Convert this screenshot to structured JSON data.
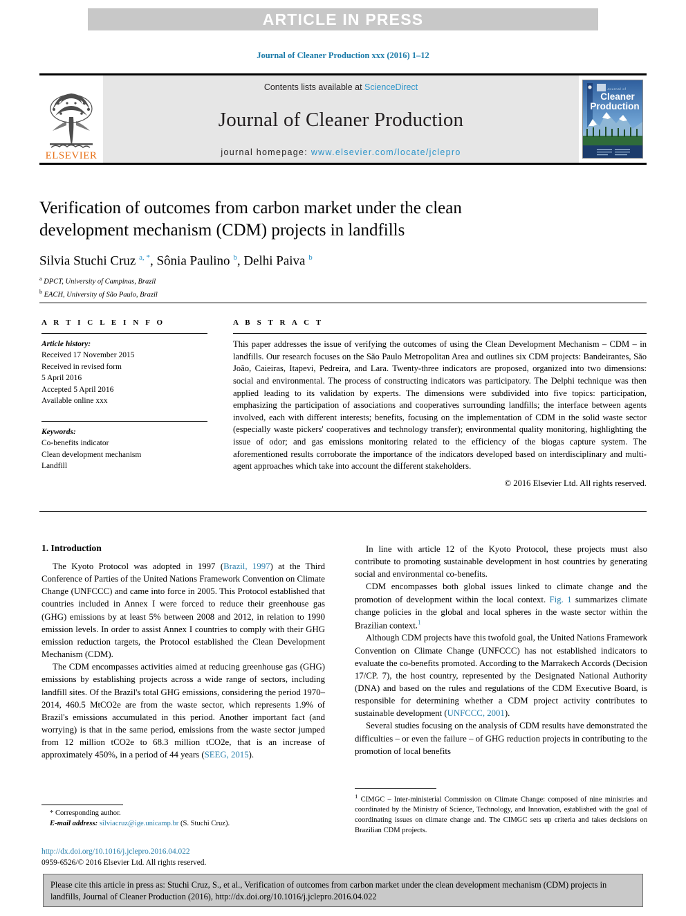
{
  "banner": {
    "text": "ARTICLE IN PRESS"
  },
  "journal_ref": "Journal of Cleaner Production xxx (2016) 1–12",
  "masthead": {
    "publisher": "ELSEVIER",
    "contents_prefix": "Contents lists available at ",
    "contents_link": "ScienceDirect",
    "journal_name": "Journal of Cleaner Production",
    "homepage_prefix": "journal homepage: ",
    "homepage_link": "www.elsevier.com/locate/jclepro",
    "cover_title_small": "Journal of",
    "cover_title_line1": "Cleaner",
    "cover_title_line2": "Production"
  },
  "title": "Verification of outcomes from carbon market under the clean development mechanism (CDM) projects in landfills",
  "authors_html": "Silvia Stuchi Cruz <sup>a, *</sup>, Sônia Paulino <sup>b</sup>, Delhi Paiva <sup>b</sup>",
  "affiliations": [
    {
      "marker": "a",
      "text": "DPCT, University of Campinas, Brazil"
    },
    {
      "marker": "b",
      "text": "EACH, University of São Paulo, Brazil"
    }
  ],
  "article_info": {
    "heading": "A R T I C L E   I N F O",
    "history_label": "Article history:",
    "history_lines": [
      "Received 17 November 2015",
      "Received in revised form",
      "5 April 2016",
      "Accepted 5 April 2016",
      "Available online xxx"
    ],
    "keywords_label": "Keywords:",
    "keywords": [
      "Co-benefits indicator",
      "Clean development mechanism",
      "Landfill"
    ]
  },
  "abstract": {
    "heading": "A B S T R A C T",
    "text": "This paper addresses the issue of verifying the outcomes of using the Clean Development Mechanism – CDM – in landfills. Our research focuses on the São Paulo Metropolitan Area and outlines six CDM projects: Bandeirantes, São João, Caieiras, Itapevi, Pedreira, and Lara. Twenty-three indicators are proposed, organized into two dimensions: social and environmental. The process of constructing indicators was participatory. The Delphi technique was then applied leading to its validation by experts. The dimensions were subdivided into five topics: participation, emphasizing the participation of associations and cooperatives surrounding landfills; the interface between agents involved, each with different interests; benefits, focusing on the implementation of CDM in the solid waste sector (especially waste pickers' cooperatives and technology transfer); environmental quality monitoring, highlighting the issue of odor; and gas emissions monitoring related to the efficiency of the biogas capture system. The aforementioned results corroborate the importance of the indicators developed based on interdisciplinary and multi-agent approaches which take into account the different stakeholders.",
    "copyright": "© 2016 Elsevier Ltd. All rights reserved."
  },
  "body": {
    "section_title": "1. Introduction",
    "left_paragraphs": [
      {
        "pre": "The Kyoto Protocol was adopted in 1997 (",
        "link": "Brazil, 1997",
        "post": ") at the Third Conference of Parties of the United Nations Framework Convention on Climate Change (UNFCCC) and came into force in 2005. This Protocol established that countries included in Annex I were forced to reduce their greenhouse gas (GHG) emissions by at least 5% between 2008 and 2012, in relation to 1990 emission levels. In order to assist Annex I countries to comply with their GHG emission reduction targets, the Protocol established the Clean Development Mechanism (CDM)."
      },
      {
        "pre": "The CDM encompasses activities aimed at reducing greenhouse gas (GHG) emissions by establishing projects across a wide range of sectors, including landfill sites. Of the Brazil's total GHG emissions, considering the period 1970–2014, 460.5 MtCO2e are from the waste sector, which represents 1.9% of Brazil's emissions accumulated in this period. Another important fact (and worrying) is that in the same period, emissions from the waste sector jumped from 12 million tCO2e to 68.3 million tCO2e, that is an increase of approximately 450%, in a period of 44 years (",
        "link": "SEEG, 2015",
        "post": ")."
      }
    ],
    "right_paragraphs": [
      {
        "pre": "In line with article 12 of the Kyoto Protocol, these projects must also contribute to promoting sustainable development in host countries by generating social and environmental co-benefits.",
        "link": "",
        "post": ""
      },
      {
        "pre": "CDM encompasses both global issues linked to climate change and the promotion of development within the local context. ",
        "link": "Fig. 1",
        "post": " summarizes climate change policies in the global and local spheres in the waste sector within the Brazilian context."
      },
      {
        "pre": "Although CDM projects have this twofold goal, the United Nations Framework Convention on Climate Change (UNFCCC) has not established indicators to evaluate the co-benefits promoted. According to the Marrakech Accords (Decision 17/CP. 7), the host country, represented by the Designated National Authority (DNA) and based on the rules and regulations of the CDM Executive Board, is responsible for determining whether a CDM project activity contributes to sustainable development (",
        "link": "UNFCCC, 2001",
        "post": ")."
      },
      {
        "pre": "Several studies focusing on the analysis of CDM results have demonstrated the difficulties – or even the failure – of GHG reduction projects in contributing to the promotion of local benefits",
        "link": "",
        "post": ""
      }
    ]
  },
  "footnotes": {
    "corresponding_label": "* Corresponding author.",
    "email_label": "E-mail address:",
    "email_link": "silviacruz@ige.unicamp.br",
    "email_suffix": "(S. Stuchi Cruz).",
    "doi_link": "http://dx.doi.org/10.1016/j.jclepro.2016.04.022",
    "issn_line": "0959-6526/© 2016 Elsevier Ltd. All rights reserved.",
    "right_marker": "1",
    "right_text": "CIMGC – Inter-ministerial Commission on Climate Change: composed of nine ministries and coordinated by the Ministry of Science, Technology, and Innovation, established with the goal of coordinating issues on climate change and. The CIMGC sets up criteria and takes decisions on Brazilian CDM projects."
  },
  "citation_footer": "Please cite this article in press as: Stuchi Cruz, S., et al., Verification of outcomes from carbon market under the clean development mechanism (CDM) projects in landfills, Journal of Cleaner Production (2016), http://dx.doi.org/10.1016/j.jclepro.2016.04.022",
  "colors": {
    "link_blue": "#2a7fab",
    "banner_gray": "#c8c8c8",
    "masthead_gray": "#e6e6e6",
    "elsevier_orange": "#e8731c",
    "footer_gray": "#c9c9c9"
  }
}
